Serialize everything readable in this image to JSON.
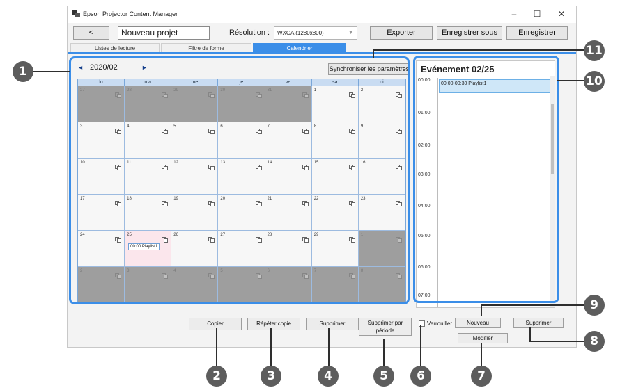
{
  "app": {
    "title": "Epson Projector Content Manager"
  },
  "window_controls": {
    "minimize": "–",
    "maximize": "☐",
    "close": "✕"
  },
  "toolbar": {
    "back_label": "<",
    "project_name": "Nouveau projet",
    "resolution_label": "Résolution :",
    "resolution_value": "WXGA (1280x800)",
    "export_label": "Exporter",
    "save_as_label": "Enregistrer sous",
    "save_label": "Enregistrer"
  },
  "tabs": [
    {
      "label": "Listes de lecture",
      "active": false
    },
    {
      "label": "Filtre de forme",
      "active": false
    },
    {
      "label": "Calendrier",
      "active": true
    }
  ],
  "calendar": {
    "month": "2020/02",
    "prev_icon": "◄",
    "next_icon": "►",
    "sync_label": "Synchroniser les paramètres",
    "weekdays": [
      "lu",
      "ma",
      "me",
      "je",
      "ve",
      "sa",
      "di"
    ],
    "days": [
      {
        "n": "27",
        "out": true
      },
      {
        "n": "28",
        "out": true
      },
      {
        "n": "29",
        "out": true
      },
      {
        "n": "30",
        "out": true
      },
      {
        "n": "31",
        "out": true
      },
      {
        "n": "1",
        "out": false
      },
      {
        "n": "2",
        "out": false
      },
      {
        "n": "3",
        "out": false
      },
      {
        "n": "4",
        "out": false
      },
      {
        "n": "5",
        "out": false
      },
      {
        "n": "6",
        "out": false
      },
      {
        "n": "7",
        "out": false
      },
      {
        "n": "8",
        "out": false
      },
      {
        "n": "9",
        "out": false
      },
      {
        "n": "10",
        "out": false
      },
      {
        "n": "11",
        "out": false
      },
      {
        "n": "12",
        "out": false
      },
      {
        "n": "13",
        "out": false
      },
      {
        "n": "14",
        "out": false
      },
      {
        "n": "15",
        "out": false
      },
      {
        "n": "16",
        "out": false
      },
      {
        "n": "17",
        "out": false
      },
      {
        "n": "18",
        "out": false
      },
      {
        "n": "19",
        "out": false
      },
      {
        "n": "20",
        "out": false
      },
      {
        "n": "21",
        "out": false
      },
      {
        "n": "22",
        "out": false
      },
      {
        "n": "23",
        "out": false
      },
      {
        "n": "24",
        "out": false
      },
      {
        "n": "25",
        "out": false,
        "selected": true,
        "event": "00:00 Playlist1"
      },
      {
        "n": "26",
        "out": false
      },
      {
        "n": "27",
        "out": false
      },
      {
        "n": "28",
        "out": false
      },
      {
        "n": "29",
        "out": false
      },
      {
        "n": "1",
        "out": true
      },
      {
        "n": "2",
        "out": true
      },
      {
        "n": "3",
        "out": true
      },
      {
        "n": "4",
        "out": true
      },
      {
        "n": "5",
        "out": true
      },
      {
        "n": "6",
        "out": true
      },
      {
        "n": "7",
        "out": true
      },
      {
        "n": "8",
        "out": true
      }
    ]
  },
  "event_panel": {
    "title": "Evénement 02/25",
    "hours": [
      "00:00",
      "01:00",
      "02:00",
      "03:00",
      "04:00",
      "05:00",
      "06:00",
      "07:00"
    ],
    "event": "00:00-00:30 Playlist1"
  },
  "buttons": {
    "copy": "Copier",
    "repeat_copy": "Répéter copie",
    "delete": "Supprimer",
    "delete_period": "Supprimer par période",
    "lock": "Verrouiller",
    "new": "Nouveau",
    "delete_event": "Supprimer",
    "edit": "Modifier"
  },
  "callouts": [
    "1",
    "2",
    "3",
    "4",
    "5",
    "6",
    "7",
    "8",
    "9",
    "10",
    "11"
  ],
  "colors": {
    "accent": "#3b8ee8",
    "callout": "#5d5d5d",
    "out_of_month": "#9e9e9e",
    "selected_day": "#fbe6ec",
    "event": "#cfe7f8"
  }
}
